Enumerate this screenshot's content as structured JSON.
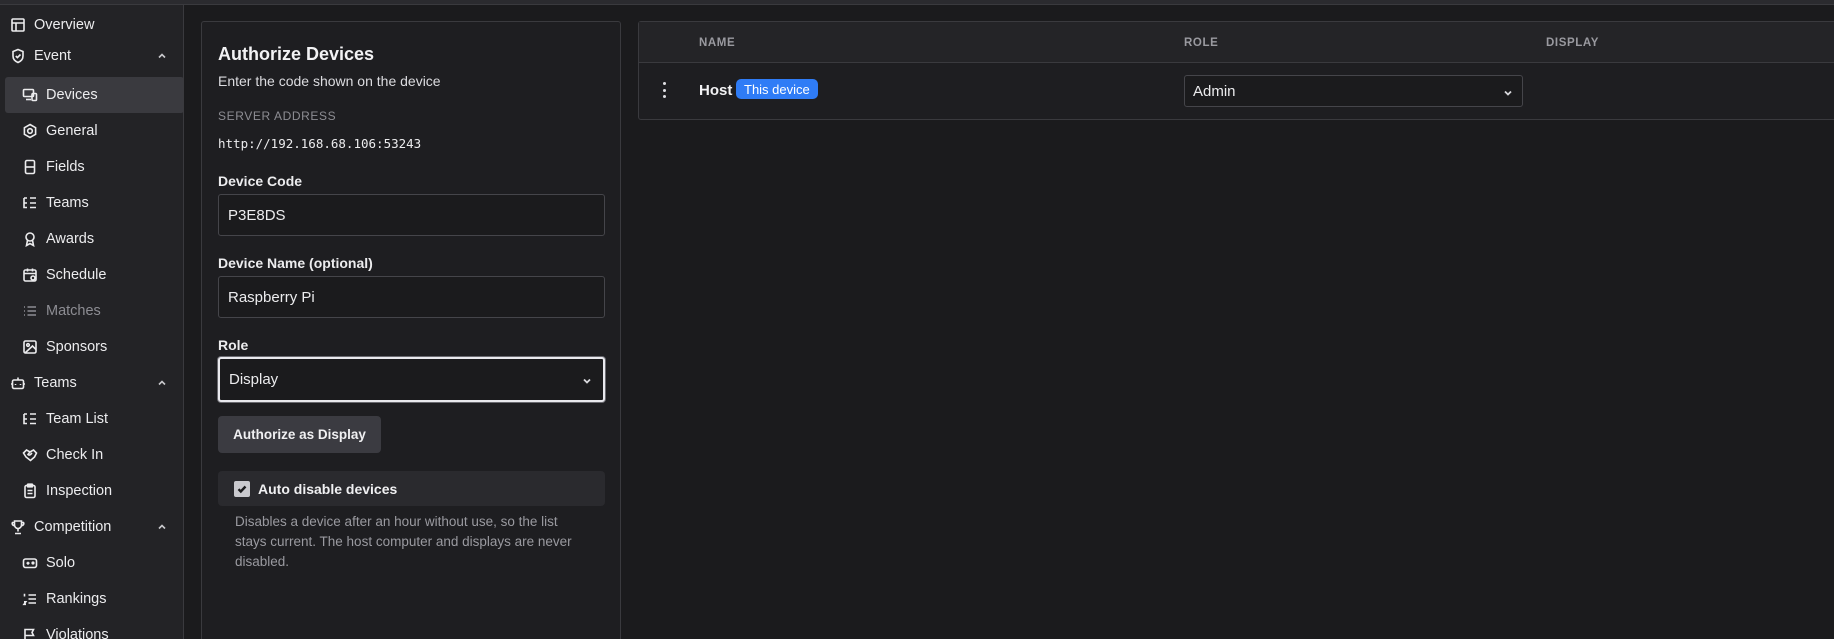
{
  "sidebar": {
    "items": [
      {
        "label": "Overview",
        "icon": "layout-icon"
      },
      {
        "label": "Event",
        "icon": "shield-icon",
        "expanded": true
      },
      {
        "label": "Devices",
        "icon": "devices-icon",
        "active": true
      },
      {
        "label": "General",
        "icon": "settings-icon"
      },
      {
        "label": "Fields",
        "icon": "fields-icon"
      },
      {
        "label": "Teams",
        "icon": "list-tree-icon"
      },
      {
        "label": "Awards",
        "icon": "award-icon"
      },
      {
        "label": "Schedule",
        "icon": "calendar-icon"
      },
      {
        "label": "Matches",
        "icon": "list-icon",
        "disabled": true
      },
      {
        "label": "Sponsors",
        "icon": "image-icon"
      },
      {
        "label": "Teams",
        "icon": "bot-icon",
        "expanded": true
      },
      {
        "label": "Team List",
        "icon": "list-tree-icon"
      },
      {
        "label": "Check In",
        "icon": "handshake-icon"
      },
      {
        "label": "Inspection",
        "icon": "clipboard-icon"
      },
      {
        "label": "Competition",
        "icon": "trophy-icon",
        "expanded": true
      },
      {
        "label": "Solo",
        "icon": "gamepad-icon"
      },
      {
        "label": "Rankings",
        "icon": "list-ordered-icon"
      },
      {
        "label": "Violations",
        "icon": "flag-icon"
      }
    ]
  },
  "authorize": {
    "title": "Authorize Devices",
    "subtitle": "Enter the code shown on the device",
    "server_label": "SERVER ADDRESS",
    "server_value": "http://192.168.68.106:53243",
    "code_label": "Device Code",
    "code_value": "P3E8DS",
    "name_label": "Device Name (optional)",
    "name_value": "Raspberry Pi",
    "role_label": "Role",
    "role_value": "Display",
    "button_label": "Authorize as Display",
    "auto_disable_label": "Auto disable devices",
    "auto_disable_checked": true,
    "auto_disable_help": "Disables a device after an hour without use, so the list stays current. The host computer and displays are never disabled."
  },
  "devices_table": {
    "columns": [
      "NAME",
      "ROLE",
      "DISPLAY"
    ],
    "rows": [
      {
        "name": "Host",
        "badge": "This device",
        "role": "Admin"
      }
    ]
  },
  "colors": {
    "accent": "#2f7cf6",
    "background": "#1b1b1d",
    "sidebar": "#232326"
  }
}
